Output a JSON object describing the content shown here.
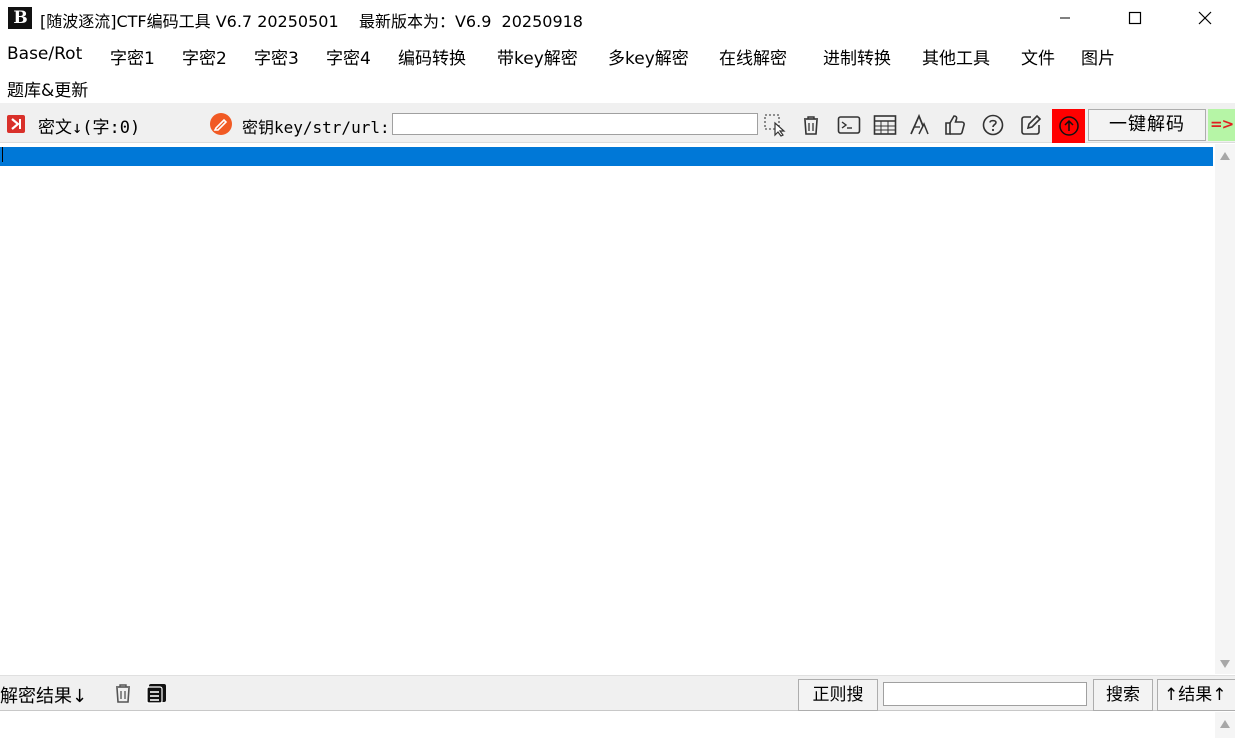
{
  "window": {
    "logo_text": "B",
    "title": "[随波逐流]CTF编码工具 V6.7 20250501    最新版本为：V6.9  20250918"
  },
  "menu": {
    "items": [
      "Base/Rot",
      "字密1",
      "字密2",
      "字密3",
      "字密4",
      "编码转换",
      "带key解密",
      "多key解密",
      "在线解密",
      "进制转换",
      "其他工具",
      "文件",
      "图片"
    ],
    "row2": [
      "题库&更新"
    ]
  },
  "toolbar": {
    "cipher_label": "密文↓(字:0)",
    "key_label": "密钥key/str/url:",
    "key_value": "",
    "decode_button": "一键解码",
    "green_tab": "=>"
  },
  "icons": {
    "tools": [
      "cursor-select-icon",
      "trash-icon",
      "terminal-icon",
      "table-icon",
      "font-icon",
      "thumbs-up-icon",
      "help-icon",
      "edit-icon"
    ],
    "stop": "arrow-up-circle-icon",
    "stop_color": "#ff0000",
    "selection_color": "#0078d7"
  },
  "result": {
    "label": "解密结果↓",
    "regex_button": "正则搜",
    "search_value": "",
    "search_button": "搜索",
    "up_button": "↑结果↑"
  }
}
